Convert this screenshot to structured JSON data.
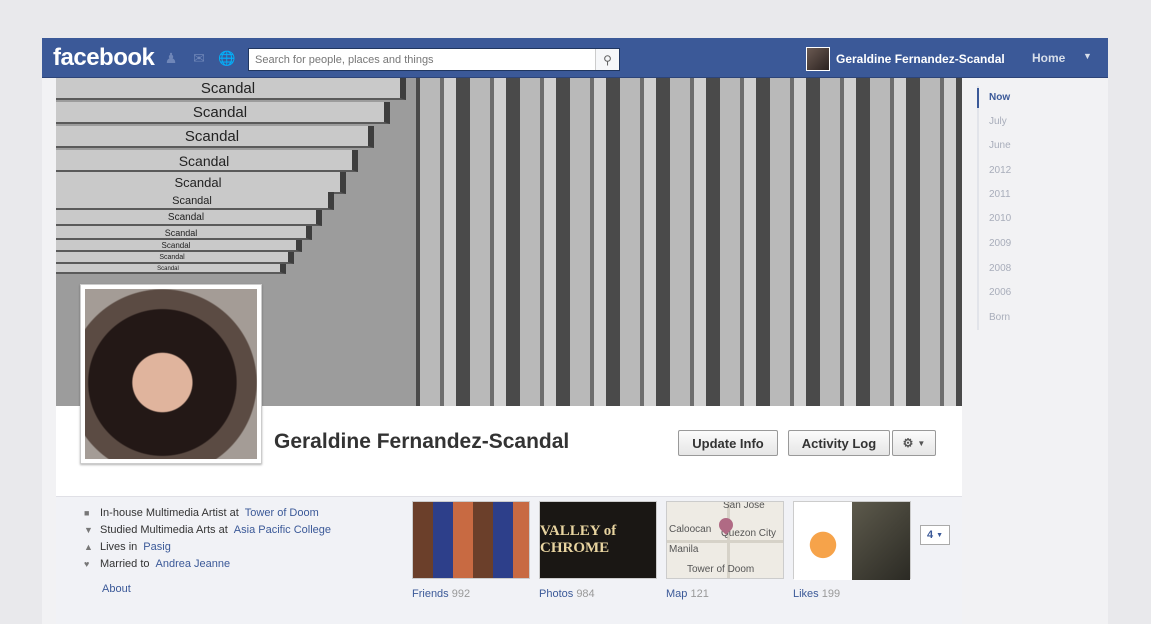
{
  "header": {
    "logo": "facebook",
    "search_placeholder": "Search for people, places and things",
    "user_name": "Geraldine Fernandez-Scandal",
    "home_label": "Home"
  },
  "cover": {
    "repeat_text": "Scandal"
  },
  "profile": {
    "name": "Geraldine Fernandez-Scandal",
    "update_info_label": "Update Info",
    "activity_log_label": "Activity Log"
  },
  "about": {
    "work_prefix": "In-house Multimedia Artist at",
    "work_link": "Tower of Doom",
    "study_prefix": "Studied Multimedia Arts at",
    "study_link": "Asia Pacific College",
    "lives_prefix": "Lives in",
    "lives_link": "Pasig",
    "married_prefix": "Married to",
    "married_link": "Andrea Jeanne",
    "about_label": "About"
  },
  "tiles": [
    {
      "label": "Friends",
      "count": "992"
    },
    {
      "label": "Photos",
      "count": "984",
      "image_text": "VALLEY of CHROME"
    },
    {
      "label": "Map",
      "count": "121",
      "map_labels": [
        "San Jose",
        "Quezon City",
        "Manila",
        "Tower of Doom",
        "Caloocan"
      ]
    },
    {
      "label": "Likes",
      "count": "199"
    }
  ],
  "more_count": "4",
  "timeline": [
    "Now",
    "July",
    "June",
    "2012",
    "2011",
    "2010",
    "2009",
    "2008",
    "2006",
    "Born"
  ]
}
